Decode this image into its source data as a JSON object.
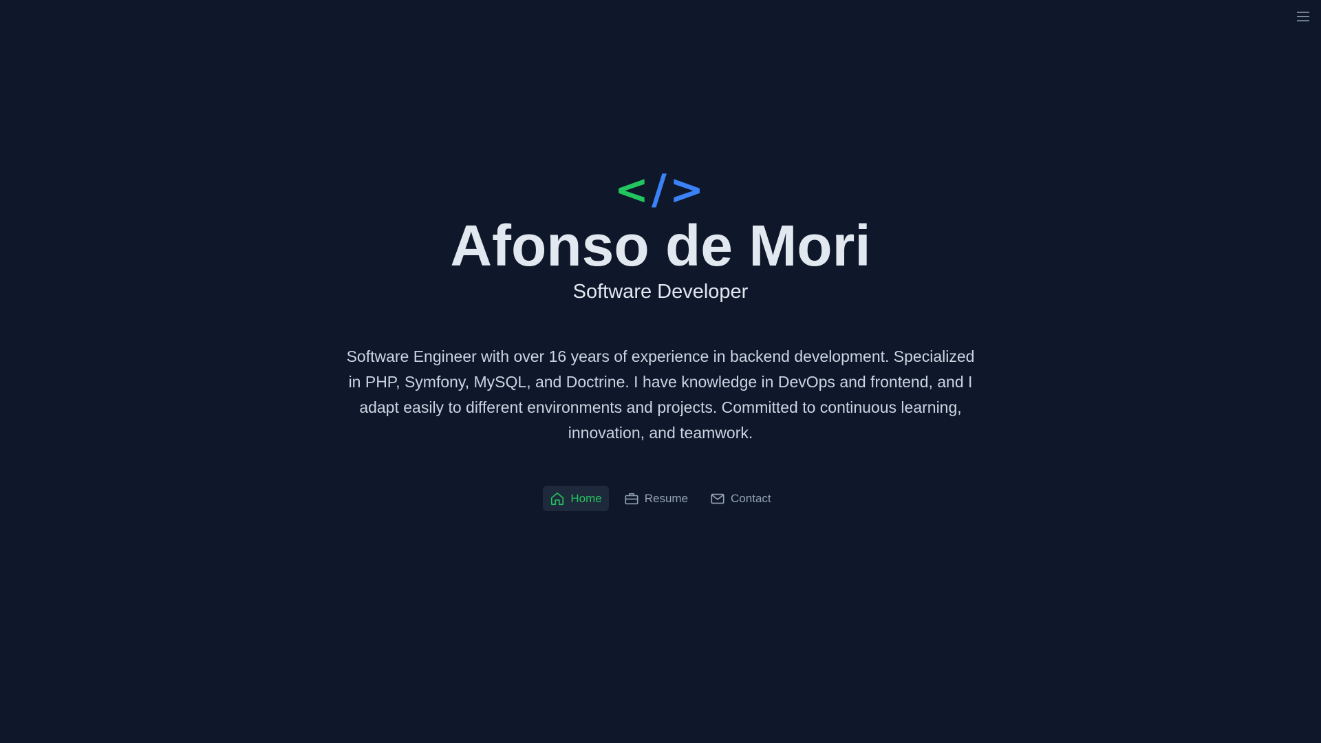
{
  "colors": {
    "background": "#0f172a",
    "accent_green": "#22c55e",
    "accent_blue": "#3b82f6",
    "text_primary": "#e2e8f0",
    "text_secondary": "#cbd5e1",
    "text_muted": "#94a3b8"
  },
  "header": {
    "menu_icon": "hamburger-menu-icon"
  },
  "hero": {
    "logo": {
      "left": "<",
      "slash": "/",
      "right": ">"
    },
    "name": "Afonso de Mori",
    "title": "Software Developer",
    "bio": "Software Engineer with over 16 years of experience in backend development. Specialized in PHP, Symfony, MySQL, and Doctrine. I have knowledge in DevOps and frontend, and I adapt easily to different environments and projects. Committed to continuous learning, innovation, and teamwork."
  },
  "nav": {
    "items": [
      {
        "label": "Home",
        "icon": "home-icon",
        "active": true
      },
      {
        "label": "Resume",
        "icon": "briefcase-icon",
        "active": false
      },
      {
        "label": "Contact",
        "icon": "mail-icon",
        "active": false
      }
    ]
  }
}
